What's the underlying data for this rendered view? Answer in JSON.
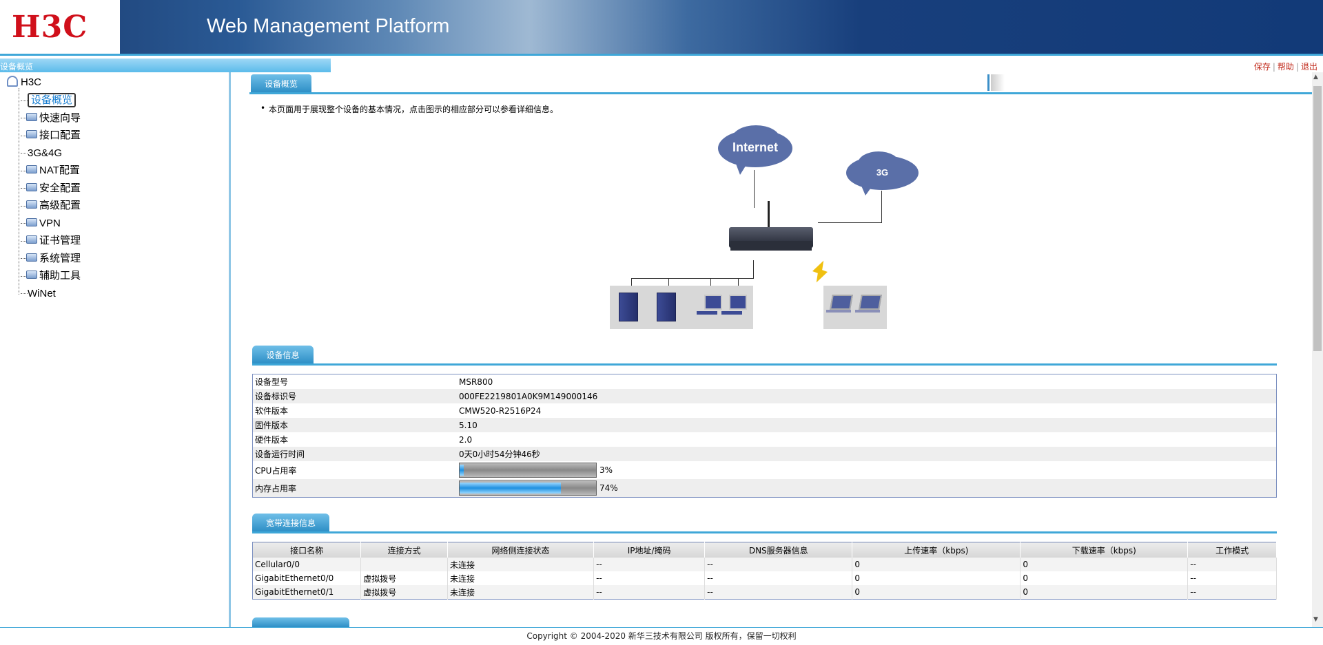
{
  "header": {
    "logo": "H3C",
    "title": "Web Management Platform"
  },
  "breadcrumb": "设备概览",
  "toplinks": {
    "save": "保存",
    "help": "帮助",
    "logout": "退出",
    "sep": "|"
  },
  "tree": {
    "root": "H3C",
    "items": [
      {
        "label": "设备概览",
        "folder": false,
        "selected": true
      },
      {
        "label": "快速向导",
        "folder": true
      },
      {
        "label": "接口配置",
        "folder": true
      },
      {
        "label": "3G&4G",
        "folder": false
      },
      {
        "label": "NAT配置",
        "folder": true
      },
      {
        "label": "安全配置",
        "folder": true
      },
      {
        "label": "高级配置",
        "folder": true
      },
      {
        "label": "VPN",
        "folder": true
      },
      {
        "label": "证书管理",
        "folder": true
      },
      {
        "label": "系统管理",
        "folder": true
      },
      {
        "label": "辅助工具",
        "folder": true
      },
      {
        "label": "WiNet",
        "folder": false
      }
    ]
  },
  "main": {
    "tab": "设备概览",
    "note": "本页面用于展现整个设备的基本情况，点击图示的相应部分可以参看详细信息。",
    "diagram": {
      "cloud_internet": "Internet",
      "cloud_3g": "3G"
    },
    "device_section": "设备信息",
    "device_info": [
      {
        "k": "设备型号",
        "v": "MSR800"
      },
      {
        "k": "设备标识号",
        "v": "000FE2219801A0K9M149000146"
      },
      {
        "k": "软件版本",
        "v": "CMW520-R2516P24"
      },
      {
        "k": "固件版本",
        "v": "5.10"
      },
      {
        "k": "硬件版本",
        "v": "2.0"
      },
      {
        "k": "设备运行时间",
        "v": "0天0小时54分钟46秒"
      }
    ],
    "cpu": {
      "label": "CPU占用率",
      "percent": 3,
      "text": "3%"
    },
    "mem": {
      "label": "内存占用率",
      "percent": 74,
      "text": "74%"
    },
    "broadband_section": "宽带连接信息",
    "broadband_headers": [
      "接口名称",
      "连接方式",
      "网络侧连接状态",
      "IP地址/掩码",
      "DNS服务器信息",
      "上传速率（kbps)",
      "下载速率（kbps)",
      "工作模式"
    ],
    "broadband_rows": [
      [
        "Cellular0/0",
        "",
        "未连接",
        "--",
        "--",
        "0",
        "0",
        "--"
      ],
      [
        "GigabitEthernet0/0",
        "虚拟拨号",
        "未连接",
        "--",
        "--",
        "0",
        "0",
        "--"
      ],
      [
        "GigabitEthernet0/1",
        "虚拟拨号",
        "未连接",
        "--",
        "--",
        "0",
        "0",
        "--"
      ]
    ]
  },
  "footer": "Copyright © 2004-2020 新华三技术有限公司 版权所有，保留一切权利"
}
